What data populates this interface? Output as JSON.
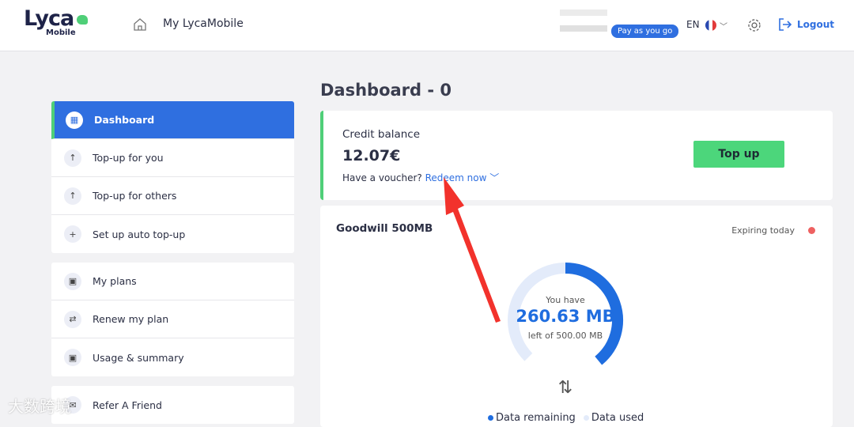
{
  "header": {
    "logo_main": "Lyca",
    "logo_sub": "Mobile",
    "brand": "My LycaMobile",
    "plan_badge": "Pay as you go",
    "language": "EN",
    "logout": "Logout"
  },
  "sidebar": {
    "groups": [
      [
        {
          "label": "Dashboard",
          "icon": "grid-icon",
          "active": true
        },
        {
          "label": "Top-up for you",
          "icon": "arrow-up-circle-icon"
        },
        {
          "label": "Top-up for others",
          "icon": "arrow-up-circle-icon"
        },
        {
          "label": "Set up auto top-up",
          "icon": "plus-circle-icon"
        }
      ],
      [
        {
          "label": "My plans",
          "icon": "plan-icon"
        },
        {
          "label": "Renew my plan",
          "icon": "renew-icon"
        },
        {
          "label": "Usage & summary",
          "icon": "plan-icon"
        }
      ],
      [
        {
          "label": "Refer A Friend",
          "icon": "gift-icon"
        }
      ]
    ]
  },
  "main": {
    "title": "Dashboard - 0",
    "credit": {
      "label": "Credit balance",
      "value": "12.07€",
      "voucher": "Have a voucher?",
      "redeem": "Redeem now",
      "topup": "Top up"
    },
    "plan": {
      "name": "Goodwill 500MB",
      "status": "Expiring today",
      "status_color": "#ee6161",
      "you_have": "You have",
      "remaining": "260.63 MB",
      "of": "left of 500.00 MB",
      "remaining_fraction": 0.5213,
      "legend_remaining": "Data remaining",
      "legend_used": "Data used"
    }
  },
  "watermark": "大数跨境"
}
